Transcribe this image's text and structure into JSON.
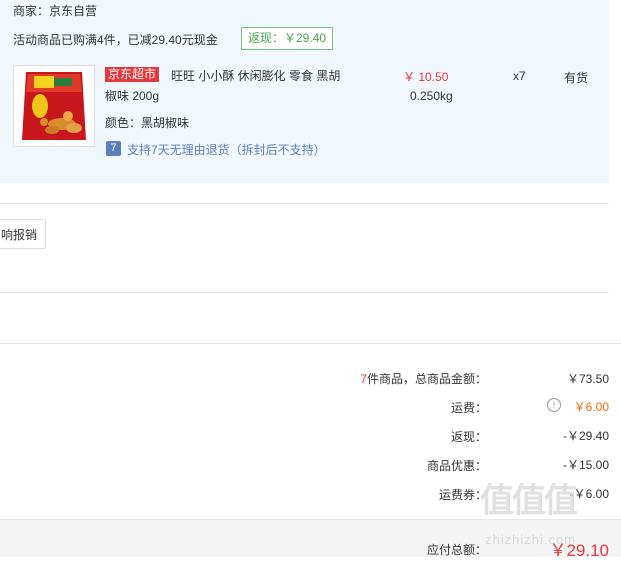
{
  "order": {
    "merchant_label": "商家：京东自营",
    "promo_text": "活动商品已购满4件，已减29.40元现金",
    "promo_badge": "返现：￥29.40",
    "item": {
      "tag": "京东超市",
      "title_line1": "旺旺 小小酥 休闲膨化 零食 黑胡",
      "title_line2": "椒味 200g",
      "price": "￥ 10.50",
      "weight": "0.250kg",
      "quantity": "x7",
      "stock": "有货",
      "color_label": "颜色：黑胡椒味",
      "return_icon": "7",
      "return_policy": "支持7天无理由退货（拆封后不支持）"
    }
  },
  "invoice": {
    "button_label": "响报销"
  },
  "summary": {
    "count": "7",
    "count_label": "件商品，总商品金额：",
    "total_goods": "￥73.50",
    "shipping_label": "运费：",
    "shipping_value": "￥6.00",
    "cashback_label": "返现：",
    "cashback_value": "-￥29.40",
    "discount_label": "商品优惠：",
    "discount_value": "-￥15.00",
    "coupon_label": "运费券：",
    "coupon_value": "-￥6.00",
    "payable_label": "应付总额：",
    "payable_value": "￥29.10"
  },
  "watermark": {
    "text": "值值值",
    "sub": "zhizhizhi.com"
  },
  "colors": {
    "accent_red": "#e4393c",
    "orange": "#ff6600",
    "green": "#4da64d",
    "link_blue": "#5b7fbe",
    "panel_bg": "#f0f8fd"
  }
}
